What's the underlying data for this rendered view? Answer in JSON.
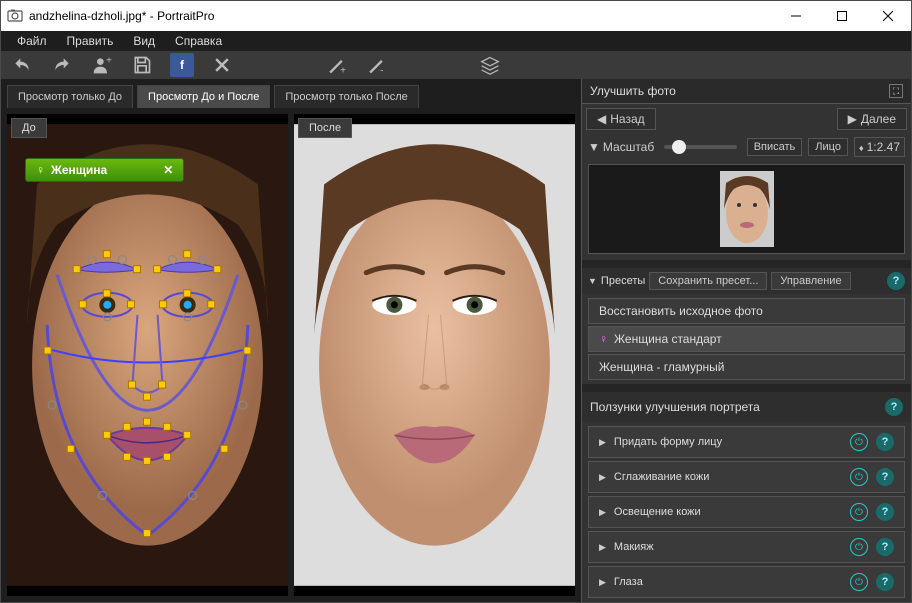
{
  "window": {
    "title": "andzhelina-dzholi.jpg* - PortraitPro"
  },
  "menu": {
    "file": "Файл",
    "edit": "Править",
    "view": "Вид",
    "help": "Справка"
  },
  "tabs": {
    "before_only": "Просмотр только До",
    "before_after": "Просмотр До и После",
    "after_only": "Просмотр только После"
  },
  "panes": {
    "before": "До",
    "after": "После"
  },
  "gender": {
    "label": "Женщина",
    "symbol": "♀"
  },
  "panel": {
    "improve_title": "Улучшить фото",
    "nav_back": "Назад",
    "nav_next": "Далее",
    "zoom_label": "Масштаб",
    "fit": "Вписать",
    "face": "Лицо",
    "zoom_value": "1:2.47",
    "presets_label": "Пресеты",
    "save_preset": "Сохранить пресет...",
    "manage": "Управление",
    "restore": "Восстановить исходное фото",
    "preset1": "Женщина стандарт",
    "preset2": "Женщина - гламурный",
    "sliders_title": "Ползунки улучшения портрета",
    "s1": "Придать форму лицу",
    "s2": "Сглаживание кожи",
    "s3": "Освещение кожи",
    "s4": "Макияж",
    "s5": "Глаза"
  }
}
